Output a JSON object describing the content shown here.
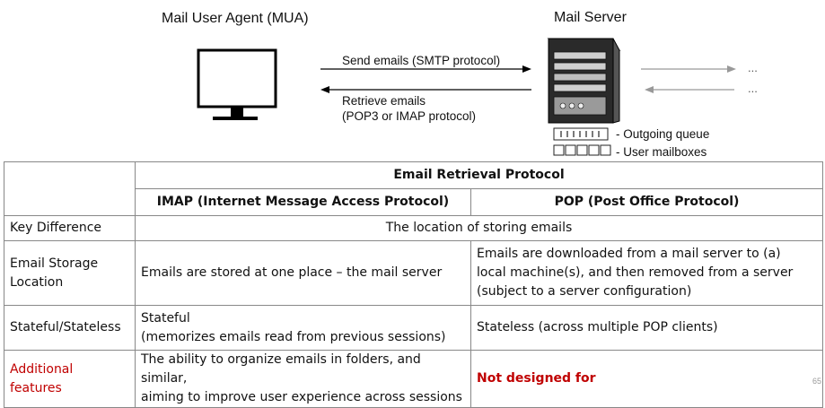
{
  "diagram": {
    "mua_label": "Mail User Agent (MUA)",
    "server_label": "Mail Server",
    "send_label": "Send emails (SMTP protocol)",
    "retrieve_label_line1": "Retrieve emails",
    "retrieve_label_line2": "(POP3 or IMAP protocol)",
    "dots_top": "...",
    "dots_bottom": "...",
    "queue_label": "- Outgoing queue",
    "mailbox_label": "- User mailboxes"
  },
  "table": {
    "group_header": "Email Retrieval Protocol",
    "col_imap": "IMAP (Internet Message Access Protocol)",
    "col_pop": "POP (Post Office Protocol)",
    "rows": [
      {
        "label": "Key Difference",
        "merged": "The location of storing emails"
      },
      {
        "label_line1": "Email Storage",
        "label_line2": "Location",
        "imap": "Emails are stored at one place – the mail server",
        "pop_line1": "Emails are downloaded from a mail server to (a)",
        "pop_line2": "local machine(s), and then removed from a server",
        "pop_line3": "(subject to a server configuration)"
      },
      {
        "label": "Stateful/Stateless",
        "imap_line1": "Stateful",
        "imap_line2": "(memorizes emails read from previous sessions)",
        "pop": "Stateless (across multiple POP clients)"
      },
      {
        "label_line1": "Additional",
        "label_line2": "features",
        "imap_line1": "The ability to organize emails in folders, and similar,",
        "imap_line2": "aiming to improve user experience across sessions",
        "pop": "Not designed for"
      }
    ]
  },
  "page_number": "65",
  "colors": {
    "accent_red": "#c00000",
    "border": "#888888"
  }
}
